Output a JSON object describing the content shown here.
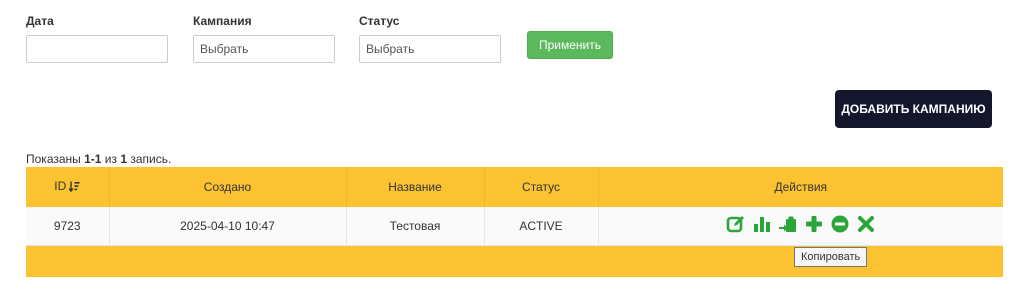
{
  "filters": {
    "date": {
      "label": "Дата",
      "value": "",
      "placeholder": ""
    },
    "campaign": {
      "label": "Кампания",
      "value": "",
      "placeholder": "Выбрать"
    },
    "status": {
      "label": "Статус",
      "value": "",
      "placeholder": "Выбрать"
    },
    "apply_label": "Применить"
  },
  "add_campaign_label": "ДОБАВИТЬ КАМПАНИЮ",
  "summary": {
    "prefix": "Показаны ",
    "range": "1-1",
    "middle": " из ",
    "total": "1",
    "suffix": " запись."
  },
  "table": {
    "columns": [
      "ID",
      "Создано",
      "Название",
      "Статус",
      "Действия"
    ],
    "rows": [
      {
        "id": "9723",
        "created": "2025-04-10 10:47",
        "name": "Тестовая",
        "status": "ACTIVE"
      }
    ]
  },
  "actions": [
    "edit-icon",
    "stats-icon",
    "copy-icon",
    "add-icon",
    "remove-icon",
    "delete-icon"
  ],
  "tooltip": "Копировать",
  "colors": {
    "accent": "#2aa53a",
    "header_bg": "#fbc232",
    "apply_bg": "#5cb85c",
    "add_bg": "#14172b"
  }
}
